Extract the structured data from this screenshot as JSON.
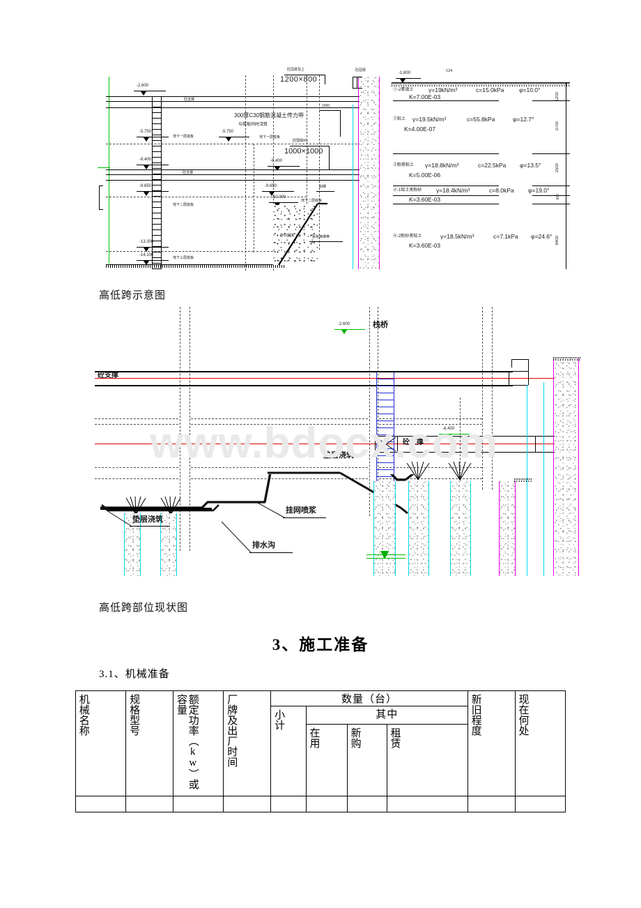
{
  "document": {
    "watermark": "www.bdocx.com"
  },
  "figure1": {
    "caption": "高低跨示意图",
    "elevations": {
      "e1": "-2.600",
      "e2": "-5.750",
      "e3": "-5.750",
      "e4": "-8.400",
      "e5": "-8.400",
      "e6": "-9.650",
      "e7": "-9.650",
      "e8": "-10.300",
      "e9": "-13.300",
      "e10": "-14.100",
      "e11": "-1.800"
    },
    "labels": {
      "strut_top": "砼支撑",
      "strut_mid": "砼支撑",
      "b1_slab": "地下一层底板",
      "b1_slab_right": "地下一层底板",
      "b2_slab": "地下二层底板",
      "b2_slab_right": "地下二层底板",
      "b3_slab": "地下三层底板",
      "crown_beam": "砼冠梁",
      "corner_note": "砼围檩WL",
      "corner_size": "1000×1000",
      "top_note": "砼冠梁及上",
      "top_size": "1200×800",
      "transfer_band": "300厚C30钢筋混凝土传力带",
      "transfer_band2": "与楼板同时浇筑",
      "gravel_fill": "砂石回填",
      "dim_1000": "1000",
      "anchor_note": "素砼换撑带",
      "pile_note": "斜撑",
      "grade_mark": "C24"
    },
    "soil_layers": [
      {
        "name": "①-2素填土",
        "gamma": "γ=19kN/m³",
        "c": "c=15.0kPa",
        "phi": "φ=10.0°",
        "k": "K=7.00E-03",
        "thickness": "1200"
      },
      {
        "name": "②粘土",
        "gamma": "γ=19.5kN/m³",
        "c": "c=55.8kPa",
        "phi": "φ=12.7°",
        "k": "K=4.00E-07",
        "thickness": "3700"
      },
      {
        "name": "③粉质粘土",
        "gamma": "γ=18.8kN/m³",
        "c": "c=22.5kPa",
        "phi": "φ=13.5°",
        "k": "K=5.00E-06",
        "thickness": "2500"
      },
      {
        "name": "④-1粘土夹粉砂",
        "gamma": "γ=18.4kN/m³",
        "c": "c=8.0kPa",
        "phi": "φ=19.0°",
        "k": "K=3.60E-03",
        "thickness": "600"
      },
      {
        "name": "④-2粉砂夹粘土",
        "gamma": "γ=18.5kN/m³",
        "c": "c=7.1kPa",
        "phi": "φ=24.6°",
        "k": "K=3.60E-03",
        "thickness": "8400"
      }
    ]
  },
  "figure2": {
    "caption": "高低跨部位现状图",
    "labels": {
      "strut_left": "砼支撑",
      "trestle": "栈桥",
      "elev_top": "-2.600",
      "elev_mid": "-8.400",
      "strut_mid": "砼支撑",
      "cushion_pour_mid": "垫层浇筑",
      "cushion_pour_left": "垫层浇筑",
      "mesh_shotcrete": "挂网喷浆",
      "drain_ditch": "排水沟"
    }
  },
  "heading": {
    "section": "3、施工准备",
    "subsection": "3.1、机械准备"
  },
  "machine_table": {
    "headers": {
      "name": "机械名称",
      "model": "规格型号",
      "power": "额定功率（kw）或容量",
      "brand_date": "厂牌及出厂时间",
      "quantity": "数量（台）",
      "subtotal": "小计",
      "among": "其中",
      "in_use": "在用",
      "new_purchase": "新购",
      "lease": "租赁",
      "condition": "新旧程度",
      "location": "现在何处"
    },
    "rows": []
  }
}
